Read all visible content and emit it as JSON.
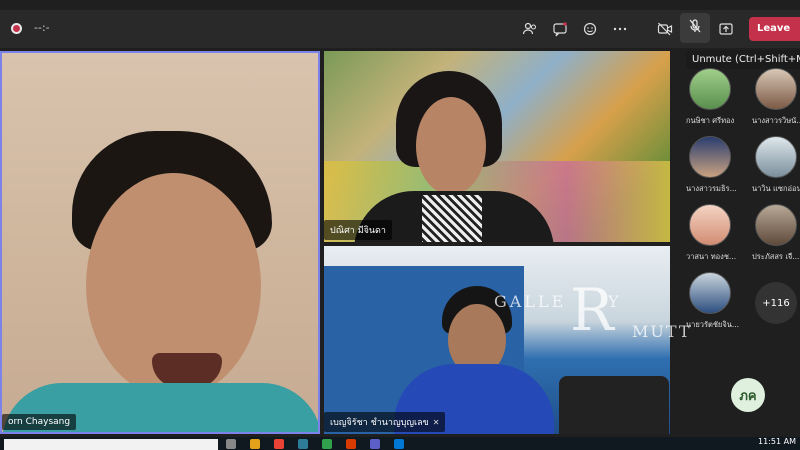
{
  "meeting": {
    "timer": "--:-",
    "leave_label": "Leave",
    "tooltip": "Unmute (Ctrl+Shift+M)"
  },
  "toolbar_icons": [
    "people-icon",
    "chat-icon",
    "reactions-icon",
    "more-icon",
    "camera-off-icon",
    "mic-off-icon",
    "share-icon"
  ],
  "video_tiles": [
    {
      "name": "orn Chaysang"
    },
    {
      "name": "ปณิศา มีจินดา"
    },
    {
      "name": "เบญจิรัชา ชำนาญบุญเลข"
    }
  ],
  "watermark": {
    "top": "GALLE",
    "letter": "R",
    "side": "Y",
    "bottom": "MUTT"
  },
  "participants": [
    {
      "name": "กนษิชา ศรีทอง"
    },
    {
      "name": "นางสาวรวิษนั..."
    },
    {
      "name": "นางสาวรมธิร..."
    },
    {
      "name": "นาวิน แซกอ่อน"
    },
    {
      "name": "วาสนา ทองช..."
    },
    {
      "name": "ประภัสสร เจื..."
    },
    {
      "name": "นายวรัตชัยจิน..."
    }
  ],
  "more_count": "+116",
  "self_initials": "ภค",
  "clock": "11:51 AM"
}
